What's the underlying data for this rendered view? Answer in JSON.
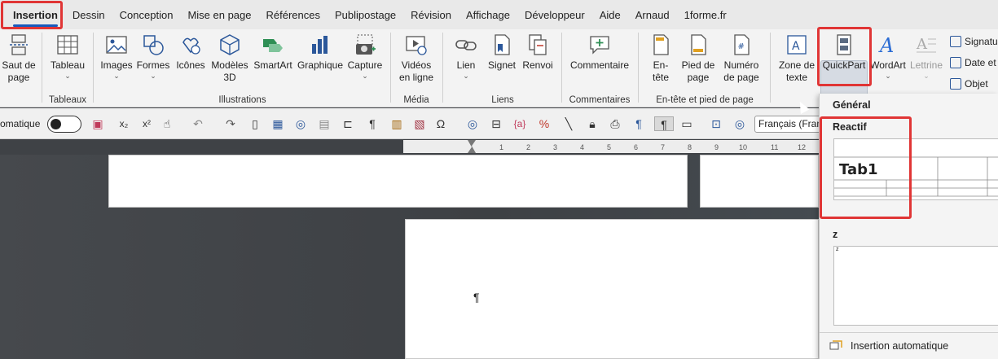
{
  "menu": {
    "tabs": [
      "Insertion",
      "Dessin",
      "Conception",
      "Mise en page",
      "Références",
      "Publipostage",
      "Révision",
      "Affichage",
      "Développeur",
      "Aide",
      "Arnaud",
      "1forme.fr"
    ]
  },
  "ribbon": {
    "page_break": [
      "Saut de",
      "page"
    ],
    "table": "Tableau",
    "images": "Images",
    "shapes": "Formes",
    "icons": "Icônes",
    "models3d": [
      "Modèles",
      "3D"
    ],
    "smartart": "SmartArt",
    "chart": "Graphique",
    "capture": "Capture",
    "videos": [
      "Vidéos",
      "en ligne"
    ],
    "link": "Lien",
    "bookmark": "Signet",
    "crossref": "Renvoi",
    "comment": "Commentaire",
    "header": [
      "En-",
      "tête"
    ],
    "footer": [
      "Pied de",
      "page"
    ],
    "page_number": [
      "Numéro",
      "de page"
    ],
    "textbox": [
      "Zone de",
      "texte"
    ],
    "quickpart": "QuickPart",
    "wordart": "WordArt",
    "dropcap": "Lettrine",
    "signature": "Signatu",
    "datetime": "Date et",
    "object": "Objet",
    "groups": {
      "tables": "Tableaux",
      "illustrations": "Illustrations",
      "media": "Média",
      "links": "Liens",
      "comments": "Commentaires",
      "header_footer": "En-tête et pied de page"
    }
  },
  "qat": {
    "autosave_label": "omatique",
    "language": "Français (Franc"
  },
  "ruler": [
    "1",
    "2",
    "3",
    "4",
    "5",
    "6",
    "7",
    "8",
    "9",
    "10",
    "11",
    "12"
  ],
  "document": {
    "pilcrow": "¶"
  },
  "dropdown": {
    "section_general": "Général",
    "section_reactif": "Reactif",
    "preview_reactif_text": "Tab1",
    "section_z": "z",
    "preview_z_text": "z",
    "footer_label": "Insertion automatique"
  }
}
